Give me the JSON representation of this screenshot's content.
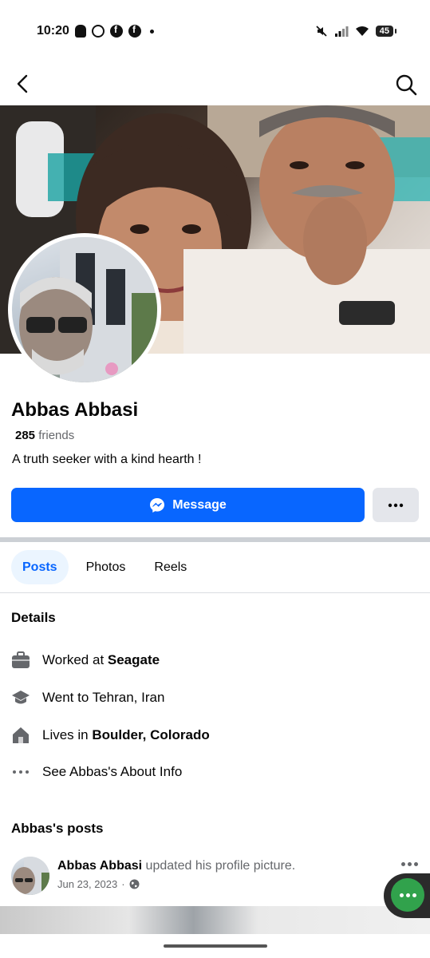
{
  "status_bar": {
    "time": "10:20",
    "battery": "45"
  },
  "profile": {
    "name": "Abbas Abbasi",
    "friends_count": "285",
    "friends_label": "friends",
    "bio": "A truth seeker with a kind hearth !"
  },
  "actions": {
    "message_label": "Message",
    "more_label": "···"
  },
  "tabs": [
    {
      "label": "Posts",
      "active": true
    },
    {
      "label": "Photos",
      "active": false
    },
    {
      "label": "Reels",
      "active": false
    }
  ],
  "details": {
    "title": "Details",
    "work_prefix": "Worked at ",
    "work_place": "Seagate",
    "education": "Went to Tehran, Iran",
    "lives_prefix": "Lives in ",
    "lives_place": "Boulder, Colorado",
    "about_link": "See Abbas's About Info"
  },
  "posts": {
    "title": "Abbas's posts",
    "items": [
      {
        "author": "Abbas Abbasi",
        "action": " updated his profile picture.",
        "date": "Jun 23, 2023",
        "audience_icon": "globe-icon"
      }
    ]
  },
  "colors": {
    "accent": "#0866ff",
    "fab": "#31a24c",
    "secondary_text": "#65676b"
  }
}
